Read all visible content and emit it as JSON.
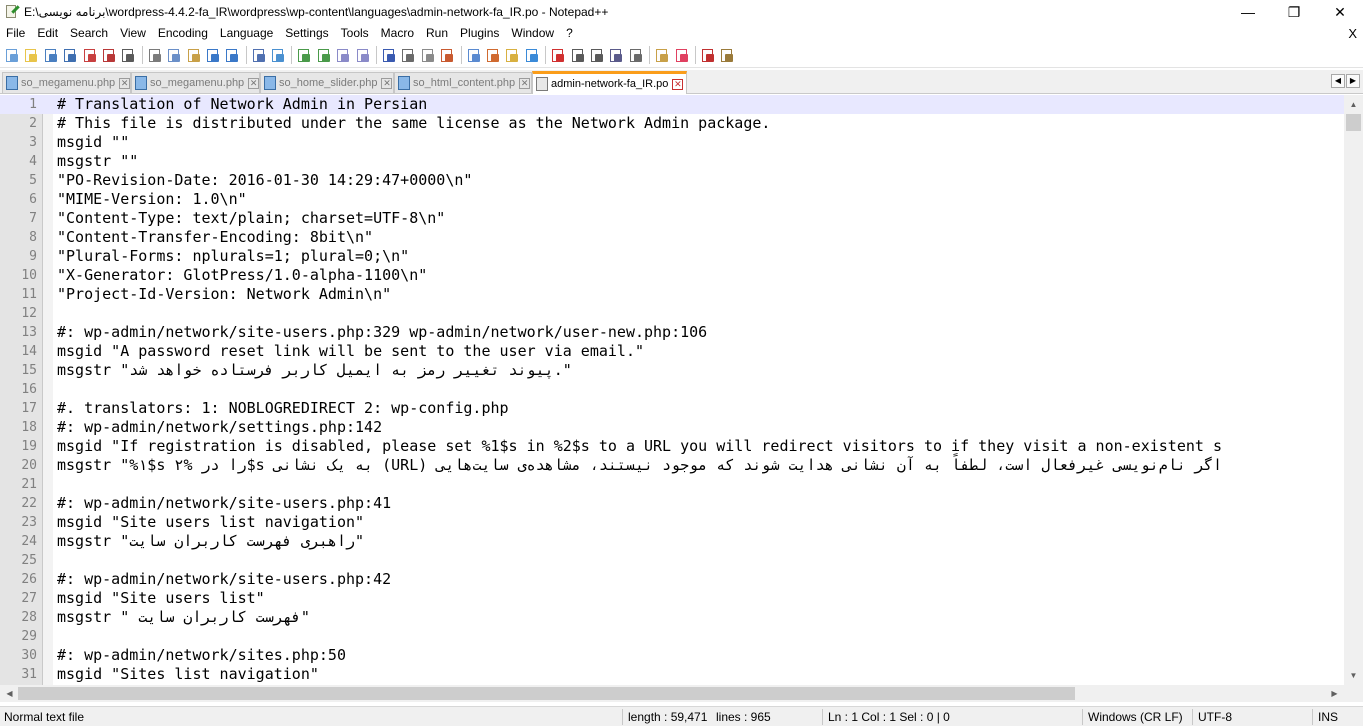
{
  "window": {
    "title": "E:\\برنامه نویسی\\wordpress-4.4.2-fa_IR\\wordpress\\wp-content\\languages\\admin-network-fa_IR.po - Notepad++",
    "minimize": "—",
    "maximize": "❐",
    "close": "✕"
  },
  "menu": {
    "items": [
      "File",
      "Edit",
      "Search",
      "View",
      "Encoding",
      "Language",
      "Settings",
      "Tools",
      "Macro",
      "Run",
      "Plugins",
      "Window",
      "?"
    ],
    "close": "X"
  },
  "toolbar": {
    "icons": [
      "new-file-icon",
      "open-file-icon",
      "save-icon",
      "save-all-icon",
      "close-icon",
      "close-all-icon",
      "print-icon",
      "cut-icon",
      "copy-icon",
      "paste-icon",
      "undo-icon",
      "redo-icon",
      "find-icon",
      "replace-icon",
      "zoom-in-icon",
      "zoom-out-icon",
      "sync-vertical-icon",
      "sync-horizontal-icon",
      "word-wrap-icon",
      "show-all-chars-icon",
      "indent-guide-icon",
      "udl-icon",
      "doc-map-icon",
      "function-list-icon",
      "folder-workspace-icon",
      "monitoring-icon",
      "record-macro-icon",
      "stop-record-icon",
      "playback-macro-icon",
      "run-macro-multiple-icon",
      "save-macro-icon",
      "plugin-icon",
      "heart-icon",
      "spell-check-icon",
      "plugin-manager-icon"
    ]
  },
  "tabs": {
    "items": [
      {
        "label": "so_megamenu.php",
        "active": false
      },
      {
        "label": "so_megamenu.php",
        "active": false
      },
      {
        "label": "so_home_slider.php",
        "active": false
      },
      {
        "label": "so_html_content.php",
        "active": false
      },
      {
        "label": "admin-network-fa_IR.po",
        "active": true
      }
    ],
    "close_glyph": "✕",
    "nav_left": "◀",
    "nav_right": "▶"
  },
  "editor": {
    "current_line": 1,
    "lines": [
      {
        "n": "1",
        "text": "# Translation of Network Admin in Persian"
      },
      {
        "n": "2",
        "text": "# This file is distributed under the same license as the Network Admin package."
      },
      {
        "n": "3",
        "text": "msgid \"\""
      },
      {
        "n": "4",
        "text": "msgstr \"\""
      },
      {
        "n": "5",
        "text": "\"PO-Revision-Date: 2016-01-30 14:29:47+0000\\n\""
      },
      {
        "n": "6",
        "text": "\"MIME-Version: 1.0\\n\""
      },
      {
        "n": "7",
        "text": "\"Content-Type: text/plain; charset=UTF-8\\n\""
      },
      {
        "n": "8",
        "text": "\"Content-Transfer-Encoding: 8bit\\n\""
      },
      {
        "n": "9",
        "text": "\"Plural-Forms: nplurals=1; plural=0;\\n\""
      },
      {
        "n": "10",
        "text": "\"X-Generator: GlotPress/1.0-alpha-1100\\n\""
      },
      {
        "n": "11",
        "text": "\"Project-Id-Version: Network Admin\\n\""
      },
      {
        "n": "12",
        "text": ""
      },
      {
        "n": "13",
        "text": "#: wp-admin/network/site-users.php:329 wp-admin/network/user-new.php:106"
      },
      {
        "n": "14",
        "text": "msgid \"A password reset link will be sent to the user via email.\""
      },
      {
        "n": "15",
        "text": "msgstr \"پیوند تغییر رمز به ایمیل کاربر فرستاده خواهد شد.\""
      },
      {
        "n": "16",
        "text": ""
      },
      {
        "n": "17",
        "text": "#. translators: 1: NOBLOGREDIRECT 2: wp-config.php"
      },
      {
        "n": "18",
        "text": "#: wp-admin/network/settings.php:142"
      },
      {
        "n": "19",
        "text": "msgid \"If registration is disabled, please set %1$s in %2$s to a URL you will redirect visitors to if they visit a non-existent s"
      },
      {
        "n": "20",
        "text": "msgstr \"%۱$s را در %۲$s به یک نشانی (URL) اگر نام‌نویسی غیرفعال است، لطفاً به آن نشانی هدایت شوند که موجود نیستند، مشاهده‌ی سایت‌هایی"
      },
      {
        "n": "21",
        "text": ""
      },
      {
        "n": "22",
        "text": "#: wp-admin/network/site-users.php:41"
      },
      {
        "n": "23",
        "text": "msgid \"Site users list navigation\""
      },
      {
        "n": "24",
        "text": "msgstr \"راهبری فهرست کاربران سایت\""
      },
      {
        "n": "25",
        "text": ""
      },
      {
        "n": "26",
        "text": "#: wp-admin/network/site-users.php:42"
      },
      {
        "n": "27",
        "text": "msgid \"Site users list\""
      },
      {
        "n": "28",
        "text": "msgstr \" فهرست کاربران سایت\""
      },
      {
        "n": "29",
        "text": ""
      },
      {
        "n": "30",
        "text": "#: wp-admin/network/sites.php:50"
      },
      {
        "n": "31",
        "text": "msgid \"Sites list navigation\""
      }
    ]
  },
  "scrollbars": {
    "up": "▲",
    "down": "▼",
    "left": "◀",
    "right": "▶"
  },
  "status": {
    "file_type": "Normal text file",
    "length": "length : 59,471",
    "lines": "lines : 965",
    "position": "Ln : 1    Col : 1    Sel : 0 | 0",
    "eol": "Windows (CR LF)",
    "encoding": "UTF-8",
    "mode": "INS"
  },
  "colors": {
    "accent_tab": "#fa9d1a",
    "current_line": "#e8e8ff",
    "gutter": "#e4e4e4"
  }
}
